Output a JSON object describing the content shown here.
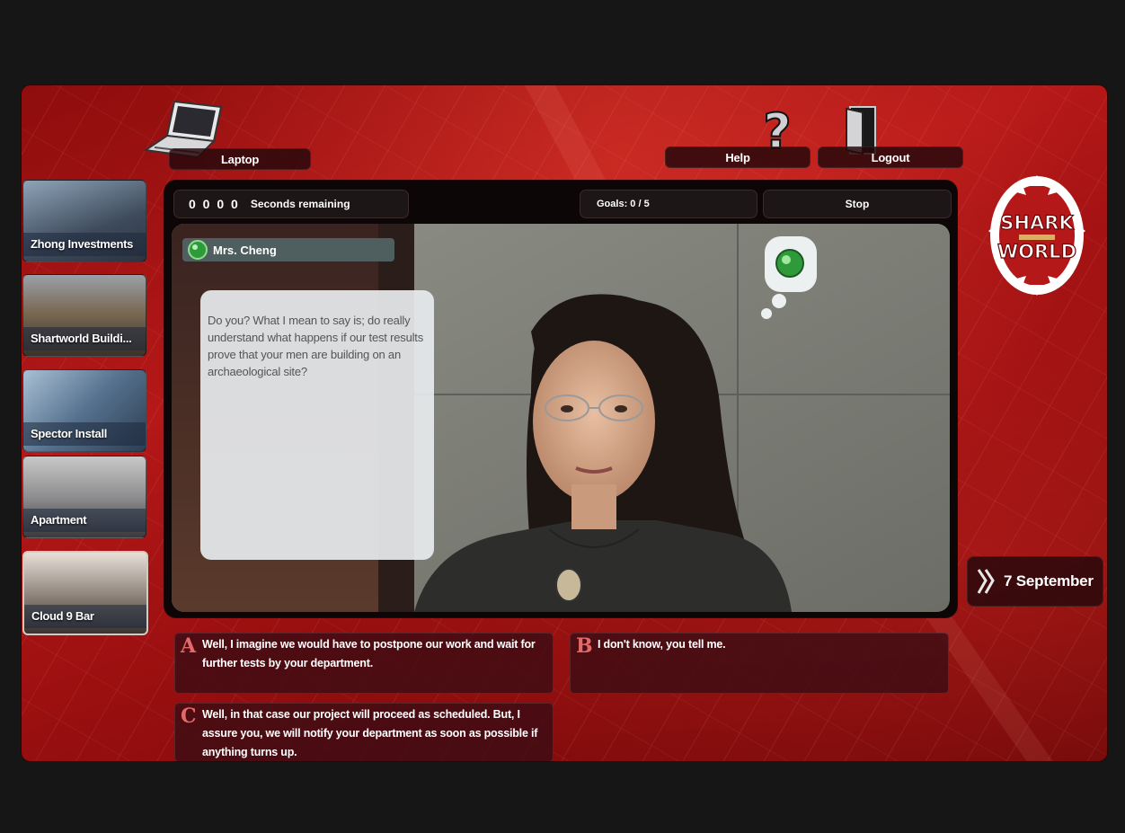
{
  "nav": {
    "laptop_label": "Laptop",
    "help_label": "Help",
    "logout_label": "Logout"
  },
  "locations": [
    {
      "label": "Zhong Investments"
    },
    {
      "label": "Shartworld Buildi..."
    },
    {
      "label": "Spector Install"
    },
    {
      "label": "Apartment"
    },
    {
      "label": "Cloud 9 Bar"
    }
  ],
  "status": {
    "timer_digits": "0 0 0 0",
    "timer_label": "Seconds remaining",
    "goals": "Goals: 0 / 5",
    "stop_label": "Stop"
  },
  "dialogue": {
    "speaker": "Mrs. Cheng",
    "text": "Do you? What I mean to say is; do really understand what happens if our test results prove that your men are building on an archaeological site?"
  },
  "answers": [
    {
      "letter": "A",
      "text": "Well, I imagine we would have to postpone our work and wait for further tests by your department."
    },
    {
      "letter": "B",
      "text": "I don't know, you tell me."
    },
    {
      "letter": "C",
      "text": "Well, in that case our project will proceed as scheduled. But, I assure you, we will notify your department as soon as possible if anything turns up."
    }
  ],
  "logo": {
    "line1": "SHARK",
    "line2": "WORLD"
  },
  "date": {
    "label": "7 September"
  },
  "colors": {
    "accent": "#b51818",
    "mood_green": "#2f9a3a"
  }
}
